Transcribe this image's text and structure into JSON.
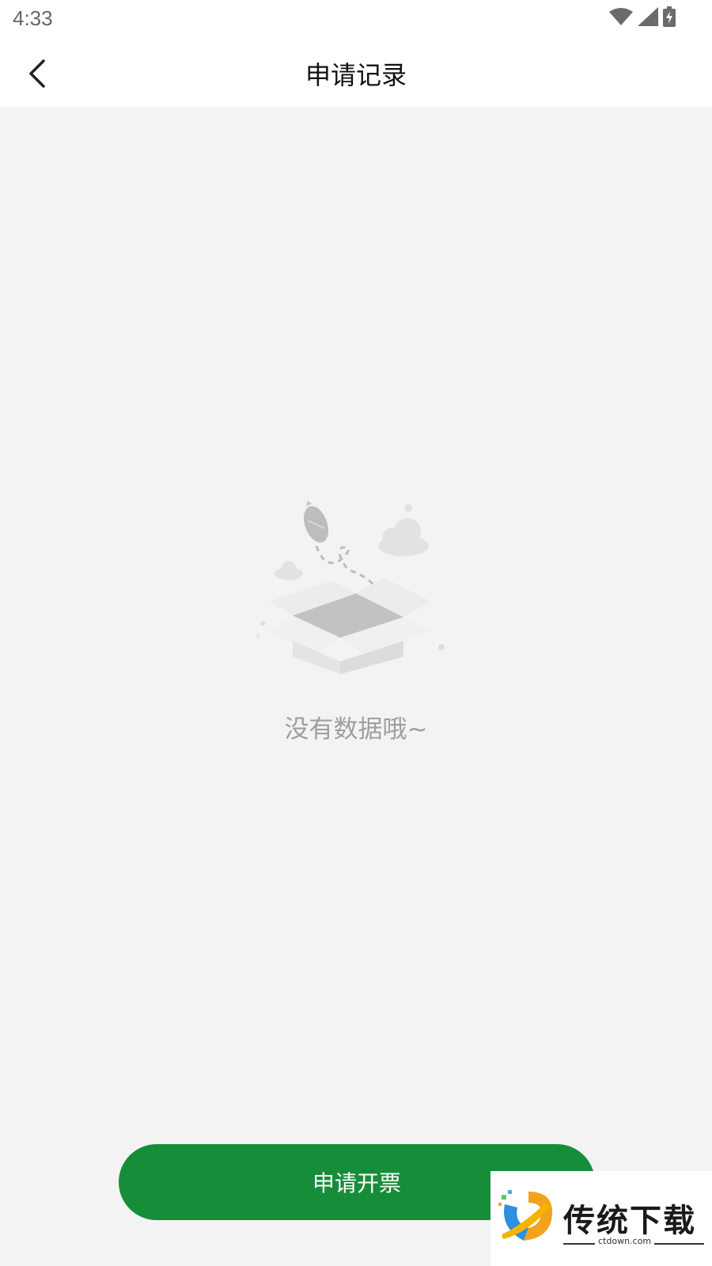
{
  "status_bar": {
    "time": "4:33",
    "icons": [
      "wifi-icon",
      "cellular-signal-icon",
      "battery-charging-icon"
    ]
  },
  "nav": {
    "back_icon": "chevron-left-icon",
    "title": "申请记录"
  },
  "empty_state": {
    "illustration": "empty-box-icon",
    "message": "没有数据哦~"
  },
  "apply_button": {
    "label": "申请开票",
    "color": "#168e39"
  },
  "watermark": {
    "name": "传统下载",
    "url": "ctdown.com"
  },
  "colors": {
    "background": "#f3f3f3",
    "header": "#ffffff",
    "accent": "#168e39",
    "muted_text": "#9e9e9e"
  }
}
